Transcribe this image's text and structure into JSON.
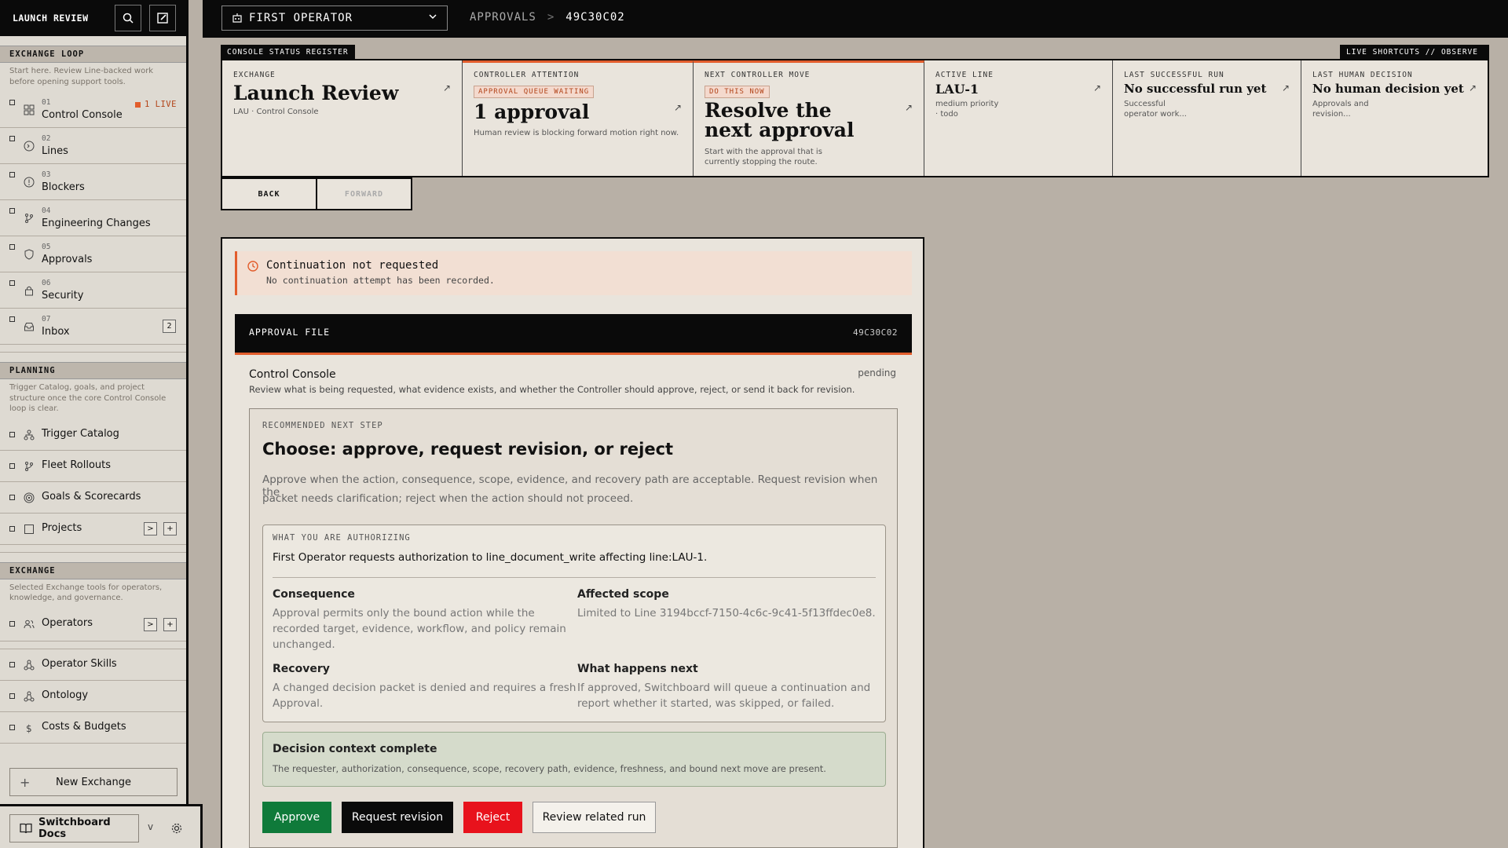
{
  "sidebar": {
    "brand": "LAUNCH REVIEW",
    "sections": {
      "exchange_loop": {
        "title": "EXCHANGE LOOP",
        "desc": "Start here. Review Line-backed work before opening support tools."
      },
      "planning": {
        "title": "PLANNING",
        "desc": "Trigger Catalog, goals, and project structure once the core Control Console loop is clear."
      },
      "exchange": {
        "title": "EXCHANGE",
        "desc": "Selected Exchange tools for operators, knowledge, and governance."
      }
    },
    "loop_items": [
      {
        "num": "01",
        "label": "Control Console",
        "badge": "1 LIVE"
      },
      {
        "num": "02",
        "label": "Lines"
      },
      {
        "num": "03",
        "label": "Blockers"
      },
      {
        "num": "04",
        "label": "Engineering Changes"
      },
      {
        "num": "05",
        "label": "Approvals"
      },
      {
        "num": "06",
        "label": "Security"
      },
      {
        "num": "07",
        "label": "Inbox",
        "count": "2"
      }
    ],
    "planning_items": [
      "Trigger Catalog",
      "Fleet Rollouts",
      "Goals & Scorecards",
      "Projects"
    ],
    "exchange_items": [
      "Operators",
      "Operator Skills",
      "Ontology",
      "Costs & Budgets"
    ],
    "mini_expand": ">",
    "mini_add": "+",
    "new_exchange": "New Exchange",
    "docs": "Switchboard Docs",
    "docs_caret": "v"
  },
  "topbar": {
    "operator": "FIRST OPERATOR",
    "crumb_section": "APPROVALS",
    "crumb_sep": ">",
    "crumb_id": "49C30C02"
  },
  "register": {
    "tag_left": "CONSOLE STATUS REGISTER",
    "tag_right": "LIVE SHORTCUTS // OBSERVE",
    "exchange": {
      "key": "EXCHANGE",
      "title": "Launch Review",
      "sub": "LAU · Control Console"
    },
    "attention": {
      "key": "CONTROLLER ATTENTION",
      "badge": "APPROVAL QUEUE WAITING",
      "title": "1 approval",
      "sub": "Human review is blocking forward motion right now."
    },
    "next_move": {
      "key": "NEXT CONTROLLER MOVE",
      "badge": "DO THIS NOW",
      "title1": "Resolve the",
      "title2": "next approval",
      "sub1": "Start with the approval that is",
      "sub2": "currently stopping the route."
    },
    "active_line": {
      "key": "ACTIVE LINE",
      "title": "LAU-1",
      "sub1": "medium priority",
      "sub2": "· todo"
    },
    "last_run": {
      "key": "LAST SUCCESSFUL RUN",
      "title": "No successful run yet",
      "sub1": "Successful",
      "sub2": "operator work..."
    },
    "last_decision": {
      "key": "LAST HUMAN DECISION",
      "title": "No human decision yet",
      "sub1": "Approvals and",
      "sub2": "revision..."
    },
    "arrow": "↗"
  },
  "nav": {
    "back": "BACK",
    "forward": "FORWARD"
  },
  "alert": {
    "title": "Continuation not requested",
    "desc": "No continuation attempt has been recorded."
  },
  "approval": {
    "header": "APPROVAL FILE",
    "id": "49C30C02",
    "title": "Control Console",
    "status": "pending",
    "desc": "Review what is being requested, what evidence exists, and whether the Controller should approve, reject, or send it back for revision."
  },
  "recommend": {
    "kicker": "RECOMMENDED NEXT STEP",
    "heading": "Choose: approve, request revision, or reject",
    "desc1": "Approve when the action, consequence, scope, evidence, and recovery path are acceptable. Request revision when the",
    "desc2": "packet needs clarification; reject when the action should not proceed."
  },
  "authorize": {
    "kicker": "WHAT YOU ARE AUTHORIZING",
    "statement": "First Operator requests authorization to line_document_write affecting line:LAU-1.",
    "consequence": {
      "label": "Consequence",
      "l1": "Approval permits only the bound action while the",
      "l2": "recorded target, evidence, workflow, and policy remain",
      "l3": "unchanged."
    },
    "scope": {
      "label": "Affected scope",
      "l1": "Limited to Line 3194bccf-7150-4c6c-9c41-5f13ffdec0e8."
    },
    "recovery": {
      "label": "Recovery",
      "l1": "A changed decision packet is denied and requires a fresh",
      "l2": "Approval."
    },
    "next": {
      "label": "What happens next",
      "l1": "If approved, Switchboard will queue a continuation and",
      "l2": "report whether it started, was skipped, or failed."
    }
  },
  "context": {
    "title": "Decision context complete",
    "desc": "The requester, authorization, consequence, scope, recovery path, evidence, freshness, and bound next move are present."
  },
  "actions": {
    "approve": "Approve",
    "revise": "Request revision",
    "reject": "Reject",
    "review": "Review related run"
  },
  "colors": {
    "accent": "#e25d2c",
    "approve": "#0f7a3a",
    "reject": "#e8121c",
    "dark": "#0a0a0a"
  }
}
